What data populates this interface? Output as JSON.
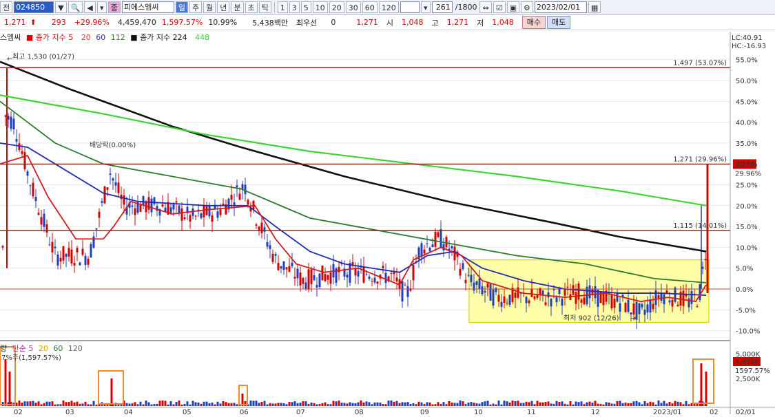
{
  "toolbar": {
    "market": "전",
    "code": "024850",
    "name": "피에스엠씨",
    "periods": [
      "일",
      "주",
      "월",
      "년",
      "분",
      "초",
      "틱"
    ],
    "numbers": [
      "1",
      "3",
      "5",
      "10",
      "20",
      "30",
      "60",
      "120"
    ],
    "count": "261",
    "total": "/1800",
    "date": "2023/02/01"
  },
  "quote": {
    "price": "1,271",
    "change": "293",
    "rate": "+29.96%",
    "volume": "4,459,470",
    "vol_rate": "1,597.57%",
    "turnover": "10.99%",
    "amount": "5,438백만",
    "priority_label": "최우선",
    "priority_val": "0",
    "prio_price": "1,271",
    "open_label": "시",
    "open": "1,048",
    "high_label": "고",
    "high": "1,271",
    "low_label": "저",
    "low": "1,048",
    "buy": "매수",
    "sell": "매도"
  },
  "legend": {
    "name": "스엠씨",
    "ma_label": "종가 지수 5",
    "ma20": "20",
    "ma60": "60",
    "ma112": "112",
    "ma224_label": "종가 지수 224",
    "ma448": "448"
  },
  "right_top": {
    "lc": "LC:40.91",
    "hc": "HC:-16.93"
  },
  "annotations": {
    "high": "최고 1,530 (01/27)",
    "low": "최저 902 (12/26)",
    "dividend": "배당락(0.00%)",
    "line_1497": "1,497 (53.07%)",
    "line_1271": "1,271 (29.96%)",
    "line_1115": "1,115 (14.01%)",
    "cur_price": "1,271",
    "cur_rate": "29.96%"
  },
  "volume": {
    "legend_label": "량",
    "legend_ma": "단순 5",
    "ma20": "20",
    "ma60": "60",
    "ma120": "120",
    "peak": "1,597.57%)",
    "peak_prefix": "7%주(",
    "cur": "4,459K",
    "cur_rate": "1597.57%",
    "tick_5000": "5,000K",
    "tick_2500": "2,500K"
  },
  "chart_data": {
    "type": "candlestick",
    "y_pct_ticks": [
      "55.0%",
      "50.0%",
      "45.0%",
      "40.0%",
      "35.0%",
      "30.0%",
      "25.0%",
      "20.0%",
      "15.0%",
      "10.0%",
      "5.0%",
      "0.0%",
      "-5.0%",
      "-10.0%"
    ],
    "x_labels": [
      "02",
      "03",
      "04",
      "05",
      "06",
      "07",
      "08",
      "09",
      "10",
      "11",
      "12",
      "2023/01",
      "02",
      "02/01"
    ],
    "ref_lines_pct": [
      53.07,
      29.96,
      14.01,
      0
    ],
    "box": {
      "pct_top": 7,
      "pct_bottom": -8
    }
  }
}
